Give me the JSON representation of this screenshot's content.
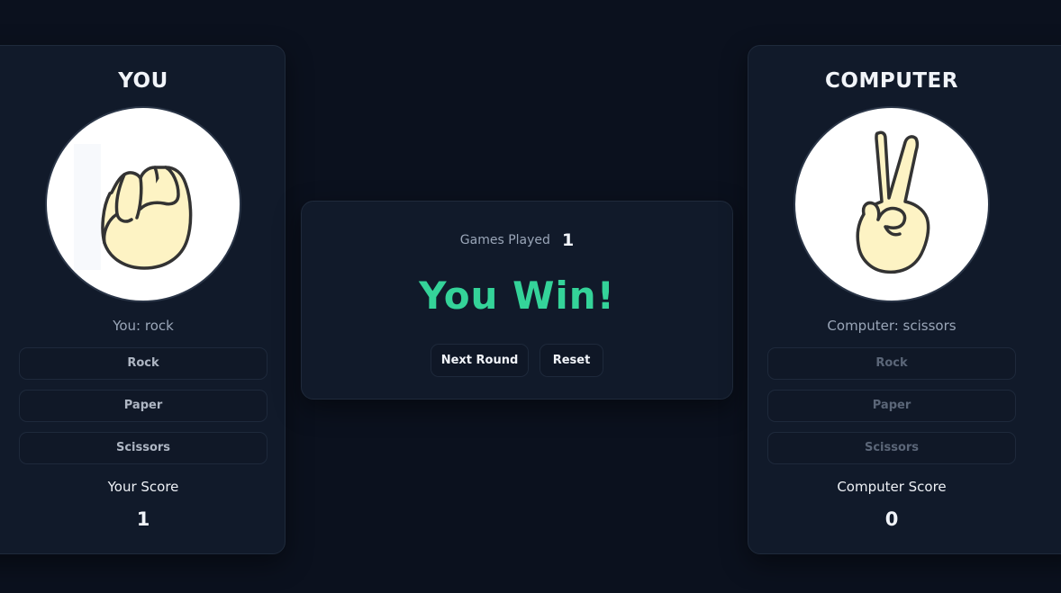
{
  "player": {
    "title": "YOU",
    "hand_icon": "rock-fist-icon",
    "choice_text": "You: rock",
    "buttons": [
      "Rock",
      "Paper",
      "Scissors"
    ],
    "score_label": "Your Score",
    "score": "1"
  },
  "computer": {
    "title": "COMPUTER",
    "hand_icon": "scissors-hand-icon",
    "choice_text": "Computer: scissors",
    "buttons": [
      "Rock",
      "Paper",
      "Scissors"
    ],
    "score_label": "Computer Score",
    "score": "0"
  },
  "center": {
    "games_played_label": "Games Played",
    "games_played": "1",
    "result": "You Win!",
    "next_round_label": "Next Round",
    "reset_label": "Reset"
  },
  "colors": {
    "background": "#0b111e",
    "card": "#111a2a",
    "win_green": "#34d399",
    "hand_fill": "#fdf3c4"
  }
}
